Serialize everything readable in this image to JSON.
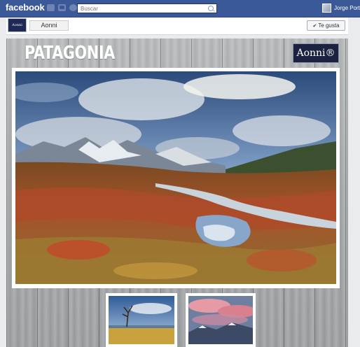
{
  "topbar": {
    "logo": "facebook",
    "search_placeholder": "Buscar",
    "user_name": "Jorge Porta"
  },
  "page_header": {
    "avatar_text": "Aonni",
    "tab_label": "Aonni",
    "like_label": "Te gusta"
  },
  "canvas": {
    "title": "PATAGONIA",
    "logo_text": "Aonni®"
  },
  "colors": {
    "fb_blue": "#3b5998",
    "wood": "#a8acae"
  }
}
